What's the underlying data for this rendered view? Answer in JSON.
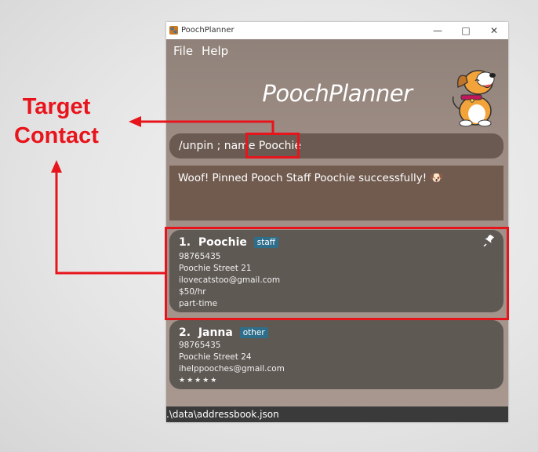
{
  "annotation": {
    "label_line1": "Target",
    "label_line2": "Contact",
    "color": "#e8141c"
  },
  "window": {
    "title": "PoochPlanner",
    "controls": [
      "minimize-icon",
      "maximize-icon",
      "close-icon"
    ]
  },
  "menu": {
    "items": [
      "File",
      "Help"
    ]
  },
  "header": {
    "app_title": "PoochPlanner"
  },
  "command": {
    "text_prefix": "/unpin ; name ",
    "text_target": "Poochie"
  },
  "result": {
    "message": "Woof! Pinned Pooch Staff Poochie successfully! 🐶"
  },
  "contacts": [
    {
      "index": "1.",
      "name": "Poochie",
      "tag": "staff",
      "phone": "98765435",
      "address": "Poochie Street 21",
      "email": "ilovecatstoo@gmail.com",
      "salary": "$50/hr",
      "employment": "part-time",
      "pinned": true
    },
    {
      "index": "2.",
      "name": "Janna",
      "tag": "other",
      "phone": "98765435",
      "address": "Poochie Street 24",
      "email": "ihelppooches@gmail.com",
      "rating": "★★★★★"
    }
  ],
  "status": {
    "path": ".\\data\\addressbook.json"
  },
  "colors": {
    "tag_bg": "#2f6e8a",
    "card_bg": "#5f5954",
    "command_bg": "#6b5a51"
  }
}
